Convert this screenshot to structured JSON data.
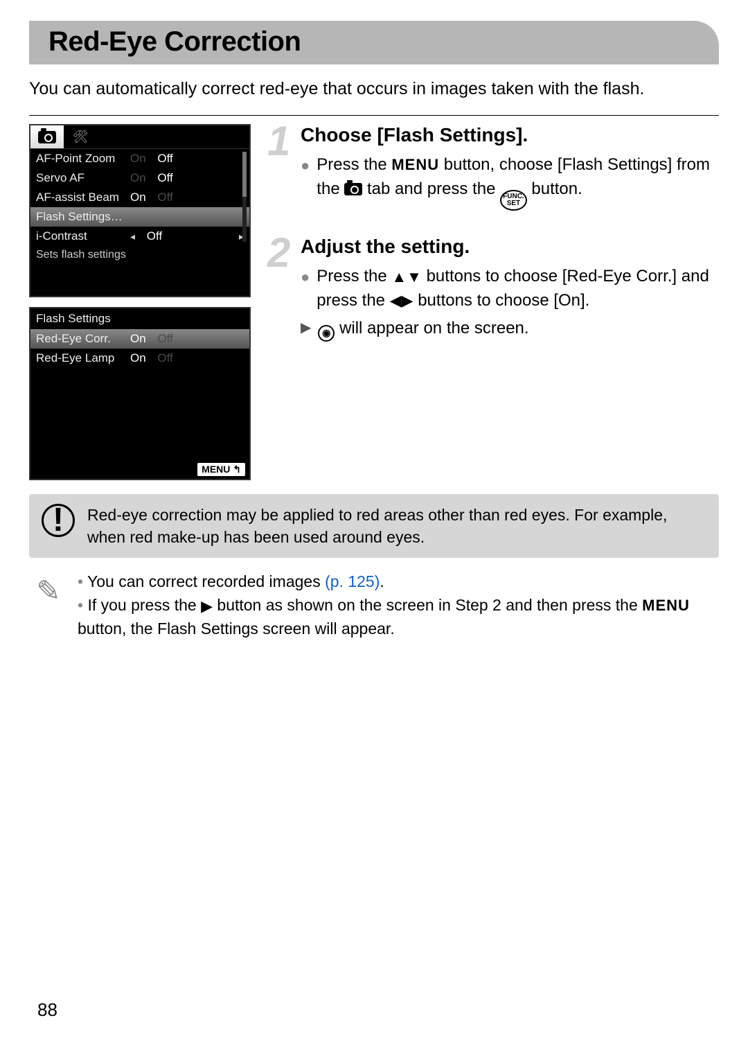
{
  "title": "Red-Eye Correction",
  "intro": "You can automatically correct red-eye that occurs in images taken with the flash.",
  "screen1": {
    "rows": [
      {
        "label": "AF-Point Zoom",
        "on_dim": "On",
        "off": "Off"
      },
      {
        "label": "Servo AF",
        "on_dim": "On",
        "off": "Off"
      },
      {
        "label": "AF-assist Beam",
        "on": "On",
        "off_dim": "Off"
      },
      {
        "label": "Flash Settings…",
        "selected": true
      },
      {
        "label": "i-Contrast",
        "caret_l": "◂",
        "val": "Off",
        "caret_r": "▸"
      }
    ],
    "hint": "Sets flash settings"
  },
  "screen2": {
    "title": "Flash Settings",
    "rows": [
      {
        "label": "Red-Eye Corr.",
        "on": "On",
        "off_dim": "Off",
        "selected": true
      },
      {
        "label": "Red-Eye Lamp",
        "on": "On",
        "off_dim": "Off"
      }
    ],
    "menu_back": "MENU ↰"
  },
  "steps": [
    {
      "num": "1",
      "heading": "Choose [Flash Settings].",
      "b1a": "Press the ",
      "b1b": " button, choose [Flash Settings] from the ",
      "b1c": " tab and press the ",
      "b1d": " button.",
      "menu_label": "MENU",
      "func_top": "FUNC.",
      "func_bot": "SET"
    },
    {
      "num": "2",
      "heading": "Adjust the setting.",
      "b1a": "Press the ",
      "b1b": " buttons to choose [Red-Eye Corr.] and press the ",
      "b1c": " buttons to choose [On].",
      "updown": "▲▼",
      "leftright": "◀▶",
      "b2a": " will appear on the screen.",
      "eye_inner": "◉"
    }
  ],
  "warning": "Red-eye correction may be applied to red areas other than red eyes. For example, when red make-up has been used around eyes.",
  "tips": {
    "t1a": "You can correct recorded images ",
    "t1link": "(p. 125)",
    "t1b": ".",
    "t2a": "If you press the ",
    "t2arrow": "▶",
    "t2b": " button as shown on the screen in Step 2 and then press the ",
    "t2menu": "MENU",
    "t2c": " button, the Flash Settings screen will appear."
  },
  "page": "88",
  "warn_mark": "!"
}
